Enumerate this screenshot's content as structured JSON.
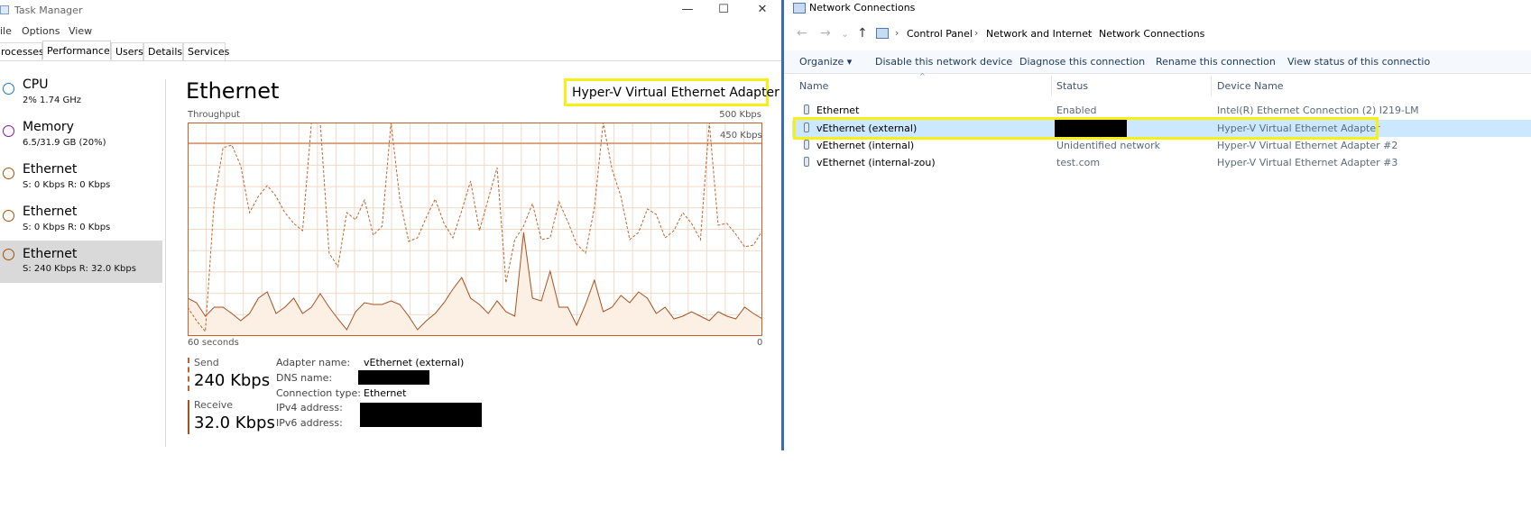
{
  "task_manager": {
    "window_title": "Task Manager",
    "window_buttons": {
      "minimize": "—",
      "maximize": "☐",
      "close": "✕"
    },
    "menu": [
      "ile",
      "Options",
      "View"
    ],
    "tabs": [
      "rocesses",
      "Performance",
      "Users",
      "Details",
      "Services"
    ],
    "active_tab": "Performance",
    "sidebar": [
      {
        "name": "CPU",
        "sub": "2% 1.74 GHz",
        "color": "#1979ca"
      },
      {
        "name": "Memory",
        "sub": "6.5/31.9 GB (20%)",
        "color": "#8b12ae"
      },
      {
        "name": "Ethernet",
        "sub": "S: 0 Kbps R: 0 Kbps",
        "color": "#a74f01"
      },
      {
        "name": "Ethernet",
        "sub": "S: 0 Kbps R: 0 Kbps",
        "color": "#a74f01"
      },
      {
        "name": "Ethernet",
        "sub": "S: 240 Kbps R: 32.0 Kbps",
        "color": "#a74f01",
        "selected": true
      }
    ],
    "detail": {
      "title": "Ethernet",
      "adapter": "Hyper-V Virtual Ethernet Adapter",
      "throughput_label": "Throughput",
      "max_label": "500 Kbps",
      "scale_line_label": "450 Kbps",
      "time_left": "60 seconds",
      "time_right": "0",
      "send": {
        "label": "Send",
        "value": "240 Kbps"
      },
      "receive": {
        "label": "Receive",
        "value": "32.0 Kbps"
      },
      "properties": {
        "adapter_name_label": "Adapter name:",
        "adapter_name": "vEthernet (external)",
        "dns_name_label": "DNS name:",
        "connection_type_label": "Connection type:",
        "connection_type": "Ethernet",
        "ipv4_label": "IPv4 address:",
        "ipv6_label": "IPv6 address:"
      }
    },
    "graph_colors": {
      "send_line": "#c0632a",
      "receive_line": "#a8511e",
      "receive_fill": "#fcefe4",
      "grid": "#f1d9c8",
      "border": "#c0632a"
    }
  },
  "network_connections": {
    "window_title": "Network Connections",
    "nav": {
      "back": "←",
      "forward": "→",
      "recent": "⌄",
      "up": "↑"
    },
    "breadcrumb": [
      "Control Panel",
      "Network and Internet",
      "Network Connections"
    ],
    "toolbar": [
      "Organize ▾",
      "Disable this network device",
      "Diagnose this connection",
      "Rename this connection",
      "View status of this connectio"
    ],
    "columns": [
      "Name",
      "Status",
      "Device Name"
    ],
    "rows": [
      {
        "name": "Ethernet",
        "status": "Enabled",
        "device": "Intel(R) Ethernet Connection (2) I219-LM"
      },
      {
        "name": "vEthernet (external)",
        "status": "",
        "device": "Hyper-V Virtual Ethernet Adapter",
        "selected": true
      },
      {
        "name": "vEthernet (internal)",
        "status": "Unidentified network",
        "device": "Hyper-V Virtual Ethernet Adapter #2"
      },
      {
        "name": "vEthernet (internal-zou)",
        "status": "test.com",
        "device": "Hyper-V Virtual Ethernet Adapter #3"
      }
    ],
    "highlight_color": "#f7ef16",
    "selection_color": "#cce8ff"
  }
}
